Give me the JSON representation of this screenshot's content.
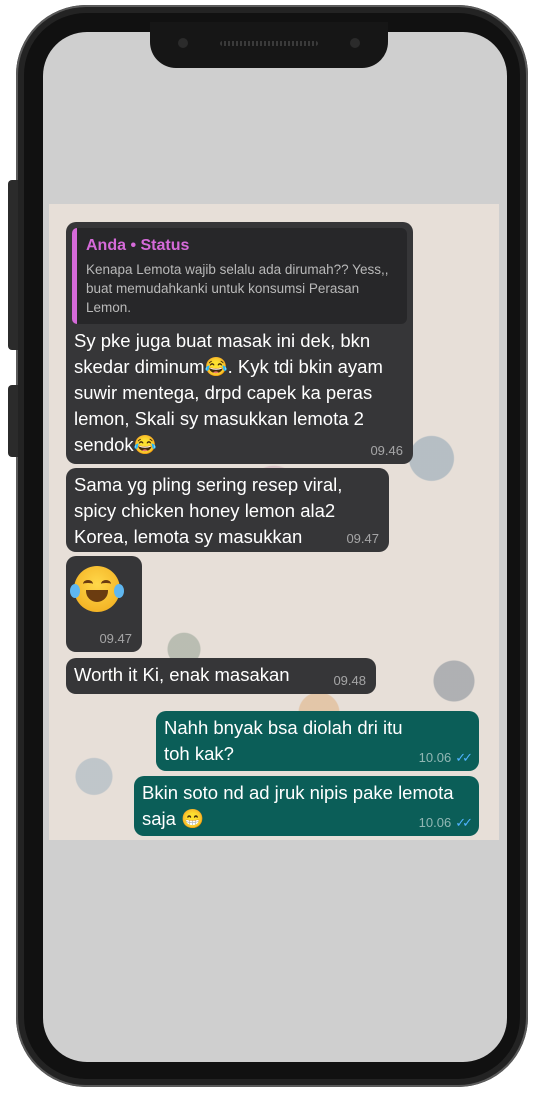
{
  "chat": {
    "messages": [
      {
        "quote_title": "Anda • Status",
        "quote_text": "Kenapa Lemota wajib selalu ada dirumah?? Yess,, buat memudahkanki untuk konsumsi Perasan Lemon.",
        "text": "Sy pke juga buat masak ini dek, bkn skedar diminum😂. Kyk tdi bkin ayam suwir mentega, drpd capek ka peras lemon, Skali sy masukkan lemota 2 sendok😂",
        "time": "09.46"
      },
      {
        "text": "Sama yg pling sering resep viral, spicy chicken honey lemon ala2 Korea, lemota sy masukkan",
        "time": "09.47"
      },
      {
        "emoji_name": "face-with-tears-of-joy-icon",
        "time": "09.47"
      },
      {
        "text": "Worth it Ki, enak masakan",
        "time": "09.48"
      },
      {
        "text": "Nahh bnyak bsa diolah dri itu toh kak?",
        "time": "10.06",
        "ticks": "✓✓"
      },
      {
        "text": "Bkin soto nd ad jruk nipis pake lemota saja 😁",
        "time": "10.06",
        "ticks": "✓✓"
      }
    ]
  },
  "colors": {
    "incoming_bubble": "#363638",
    "outgoing_bubble": "#0b5e58",
    "quote_accent": "#d56ad9",
    "read_ticks": "#4fb3ff"
  }
}
